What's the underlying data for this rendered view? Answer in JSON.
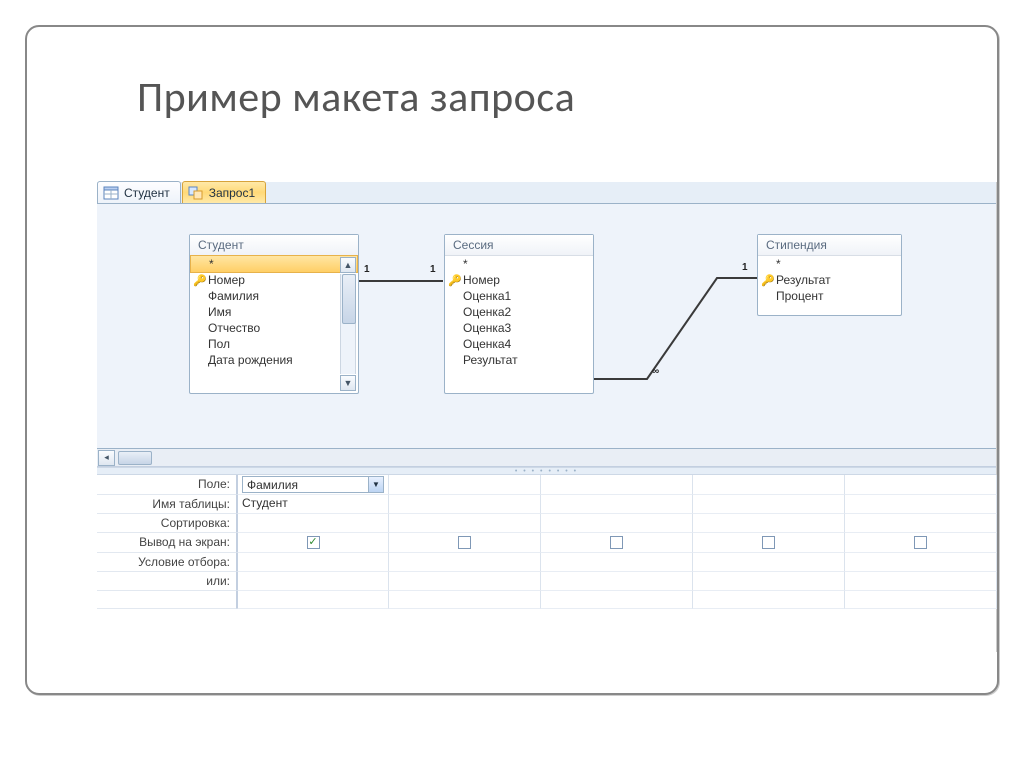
{
  "slide": {
    "title": "Пример макета запроса"
  },
  "tabs": [
    {
      "label": "Студент",
      "active": false
    },
    {
      "label": "Запрос1",
      "active": true
    }
  ],
  "entities": {
    "student": {
      "title": "Студент",
      "fields": [
        "*",
        "Номер",
        "Фамилия",
        "Имя",
        "Отчество",
        "Пол",
        "Дата рождения"
      ],
      "key_index": 1,
      "selected_index": 0,
      "has_scrollbar": true
    },
    "session": {
      "title": "Сессия",
      "fields": [
        "*",
        "Номер",
        "Оценка1",
        "Оценка2",
        "Оценка3",
        "Оценка4",
        "Результат"
      ],
      "key_index": 1
    },
    "stipend": {
      "title": "Стипендия",
      "fields": [
        "*",
        "Результат",
        "Процент"
      ],
      "key_index": 1
    }
  },
  "relations": {
    "r1": {
      "left": "1",
      "right": "1"
    },
    "r2": {
      "left": "∞",
      "right": "1"
    }
  },
  "grid": {
    "rows": {
      "field": "Поле:",
      "table": "Имя таблицы:",
      "sort": "Сортировка:",
      "show": "Вывод на экран:",
      "criteria": "Условие отбора:",
      "or": "или:"
    },
    "col1": {
      "field": "Фамилия",
      "table": "Студент",
      "show_checked": true
    }
  }
}
